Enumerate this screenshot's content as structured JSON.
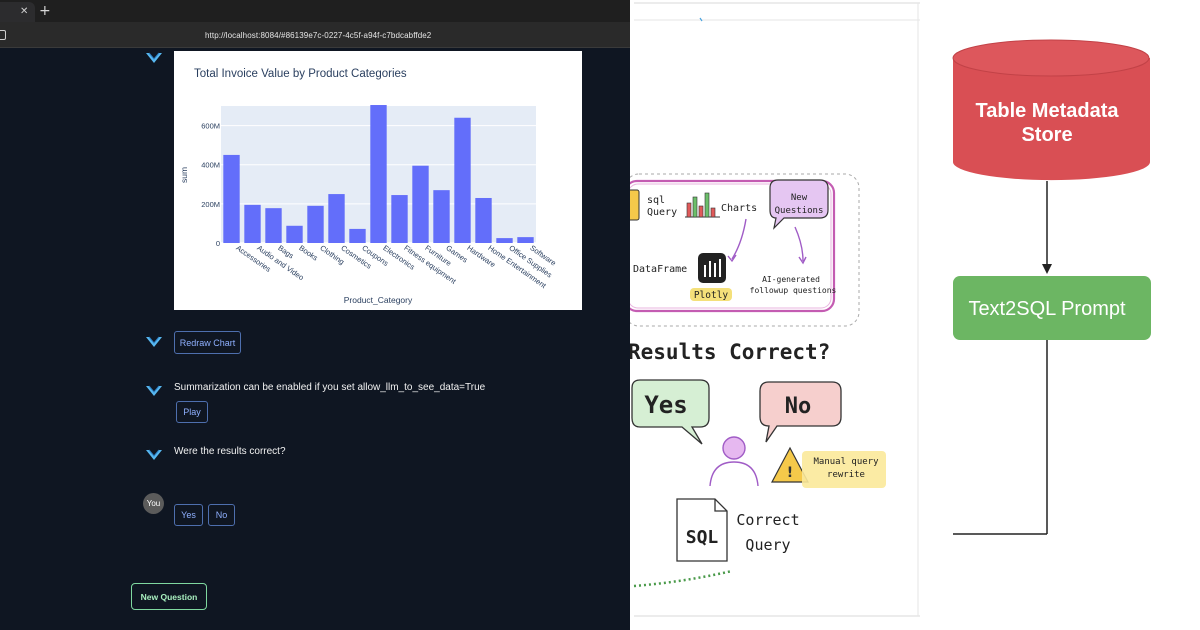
{
  "browser": {
    "url": "http://localhost:8084/#86139e7c-0227-4c5f-a94f-c7bdcabffde2",
    "tab_close_icon": "close-icon",
    "new_tab_icon": "plus-icon"
  },
  "chat": {
    "messages": {
      "summarization_text": "Summarization can be enabled if you set allow_llm_to_see_data=True",
      "results_question": "Were the results correct?"
    },
    "buttons": {
      "redraw_chart": "Redraw Chart",
      "play": "Play",
      "yes": "Yes",
      "no": "No",
      "new_question": "New Question"
    },
    "user_label": "You",
    "accent_color": "#636efa"
  },
  "chart_data": {
    "type": "bar",
    "title": "Total Invoice Value by Product Categories",
    "xlabel": "Product_Category",
    "ylabel": "sum",
    "yticks": [
      "0",
      "200M",
      "400M",
      "600M"
    ],
    "ylim": [
      0,
      700000000
    ],
    "categories": [
      "Accessories",
      "Audio and Video",
      "Bags",
      "Books",
      "Clothing",
      "Cosmetics",
      "Coupons",
      "Electronics",
      "Fitness equipment",
      "Furniture",
      "Games",
      "Hardware",
      "Home Entertainment",
      "Office Supplies",
      "Software"
    ],
    "values": [
      450000000,
      195000000,
      178000000,
      88000000,
      190000000,
      250000000,
      72000000,
      705000000,
      245000000,
      395000000,
      270000000,
      640000000,
      230000000,
      25000000,
      30000000
    ],
    "grid": true,
    "bar_color": "#636efa"
  },
  "sketch": {
    "labels": {
      "sql_query": [
        "sql",
        "Query"
      ],
      "charts": "Charts",
      "new_questions": [
        "New",
        "Questions"
      ],
      "dataframe": "DataFrame",
      "plotly": "Plotly",
      "ai_generated": [
        "AI-generated",
        "followup questions"
      ],
      "results_correct": "Results Correct?",
      "yes": "Yes",
      "no": "No",
      "manual_rewrite": [
        "Manual query",
        "rewrite"
      ],
      "sql": "SQL",
      "correct_query": [
        "Correct",
        "Query"
      ]
    }
  },
  "diagram": {
    "store_label": [
      "Table Metadata",
      "Store"
    ],
    "prompt_label": "Text2SQL Prompt",
    "store_color": "#d94f54",
    "prompt_color": "#6cb663"
  }
}
